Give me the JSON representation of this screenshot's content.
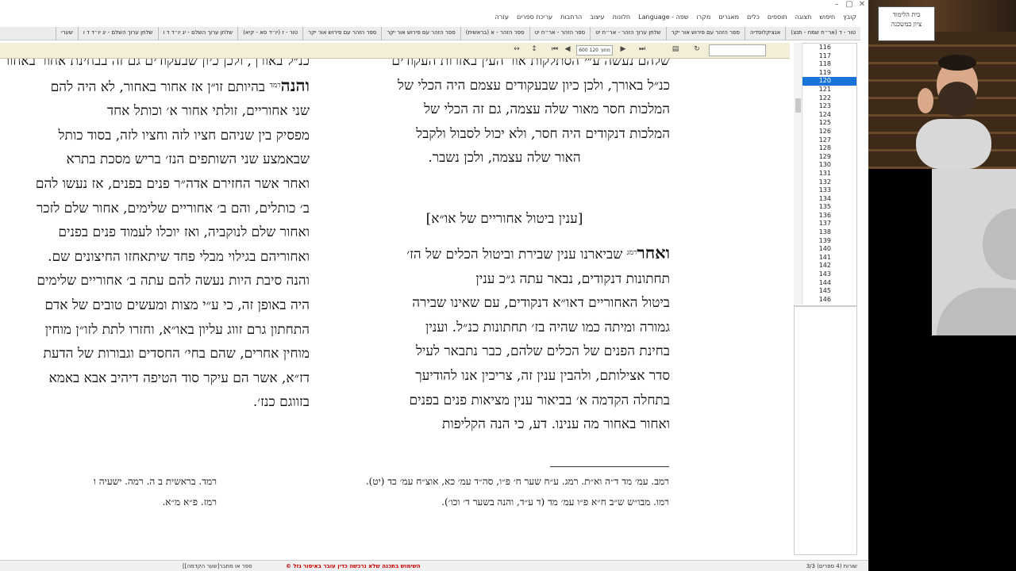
{
  "window": {
    "controls": [
      "–",
      "▢",
      "✕"
    ]
  },
  "menu": [
    "קובץ",
    "חיפוש",
    "תצוגה",
    "תוספים",
    "כלים",
    "מאגרים",
    "מקרו",
    "Language - שפה",
    "חלונות",
    "עיצוב",
    "הרחבות",
    "עריכת ספרים",
    "עזרה"
  ],
  "tabs": [
    "טור - ד (אר״ח שמח - תנצ)",
    "אנציקלופדיה",
    "ספר הזהר עם פירוש אור יקר",
    "שלחן ערוך הזהר - אר״ח יט",
    "ספר הזהר - אר״ח יט",
    "ספר הזהר - א (בראשית)",
    "ספר הזהר עם פירוש אור יקר",
    "ספר הזהר עם פירוש אור יקר",
    "טור - ז (יו״ד סא - קיא)",
    "שלחן ערוך השלם - יג יו״ד ד ו",
    "שלחן ערוך השלם - יג יו״ד ד ו",
    "שערי"
  ],
  "toolbar": {
    "page_indicator": "600 מתוך 120"
  },
  "right_column": {
    "lines_top": [
      "שלהם נעשה ע״י הסתלקות אור העין באזרות העקודים",
      "כנ״ל באורך, ולכן כיון שבעקודים עצמם היה הכלי של",
      "המלכות חסר מאור שלה עצמה, גם זה הכלי של",
      "המלכות דנקודים היה חסר, ולא יכול לסבול ולקבל",
      "האור שלה עצמה, ולכן נשבר."
    ],
    "heading": "[ענין ביטול אחוריים של או״א]",
    "lead_word": "ואחר",
    "lead_ref": "רמג",
    "para2_first": " שביארנו ענין שבירת וביטול הכלים של הז׳",
    "para2_lines": [
      "תחתונות דנקודים, נבאר עתה ג״כ ענין",
      "ביטול האחוריים דאו״א דנקודים, עם שאינו שבירה",
      "גמורה ומיתה כמו שהיה בז׳ תחתונות כנ״ל. וענין",
      "בחינת הפנים של הכלים שלהם, כבר נתבאר לעיל",
      "סדר אצילותם, ולהבין ענין זה, צריכין אנו להודיעך",
      "בתחלה הקדמה א׳ בביאור ענין מציאות פנים בפנים",
      "ואחור באחור מה ענינו. דע, כי הנה הקליפות"
    ]
  },
  "left_column": {
    "line0": "כנ״ל באורך, ולכן כיון שבעקודים גם זה בבחינת אחור באחור",
    "lead_word": "והנה",
    "lead_ref": "רמד",
    "line1": " בהיותם זו״ן אז אחור באחור, לא היה להם",
    "lines": [
      "שני אחוריים, זולתי אחור א׳ וכותל אחד",
      "מפסיק בין שניהם חציו לזה וחציו לזה, בסוד כותל",
      "שבאמצע שני השותפים הנז׳ בריש מסכת בתרא",
      "ואחר אשר החזירם אדה״ר פנים בפנים, אז נעשו להם",
      "ב׳ כותלים, והם ב׳ אחוריים שלימים, אחור שלם לזכר",
      "ואחור שלם לנוקביה, ואז יוכלו לעמוד פנים בפנים",
      "ואחוריהם בגילוי מבלי פחד שיתאחזו החיצונים שם.",
      "והנה סיבת היות נעשה להם עתה ב׳ אחוריים שלימים",
      "היה באופן זה, כי ע״י מצות ומעשים טובים של אדם",
      "התחתון גרם זווג עליון באו״א, וחזרו לתת לזו״ן מוחין",
      "מוחין אחרים, שהם בחי׳ החסדים וגבורות של הדעת",
      "דז״א, אשר הם עיקר סוד הטיפה דיהיב אבא באמא",
      "בזווגם כנז׳."
    ]
  },
  "footnotes": {
    "right_1": "רמב. עמ׳ מד ד״ה וא״ת. רמג. ע״ח שער ח׳ פ״ו, סה״ד עמ׳ כא, אוצ״ח עמ׳ כד (יט).",
    "right_2": "רמו. מבו״ש ש״ב ח״א פ״ו עמ׳ מד (ד ע״ד, והנה בשער ד׳ וכו׳).",
    "left_1": "רמד. בראשית ב ה. רמה. ישעיה ו",
    "left_2": "רמז. פ״א מ״א."
  },
  "sidebar": {
    "numbers": [
      "116",
      "117",
      "118",
      "119",
      "120",
      "121",
      "122",
      "123",
      "124",
      "125",
      "126",
      "127",
      "128",
      "129",
      "130",
      "131",
      "132",
      "133",
      "134",
      "135",
      "136",
      "137",
      "138",
      "139",
      "140",
      "141",
      "142",
      "143",
      "144",
      "145",
      "146"
    ],
    "selected": "120"
  },
  "status": {
    "count": "3/3 שורות (4 ספרים)",
    "warning": "© השימוש בתכנה שלא נרכשה כדין עובר באיסור גזל",
    "path": "[[שער הקדמה]ספר או מחבר"
  },
  "video": {
    "logo_line1": "בית הלימוד",
    "logo_line2": "ציון במשכנה"
  },
  "colors": {
    "accent": "#1a73d9",
    "toolbar_bg": "#f2eed7",
    "warning": "#cc0000"
  }
}
